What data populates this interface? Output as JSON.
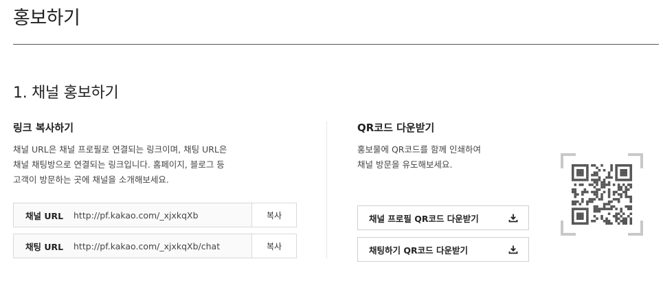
{
  "page": {
    "title": "홍보하기"
  },
  "section": {
    "title": "1. 채널 홍보하기"
  },
  "link_copy": {
    "title": "링크 복사하기",
    "description": [
      "채널 URL은 채널 프로필로 연결되는 링크이며, 채팅 URL은",
      "채널 채팅방으로 연결되는 링크입니다. 홈페이지, 블로그 등",
      "고객이 방문하는 곳에 채널을 소개해보세요."
    ],
    "rows": [
      {
        "label": "채널 URL",
        "url": "http://pf.kakao.com/_xjxkqXb",
        "button": "복사"
      },
      {
        "label": "채팅 URL",
        "url": "http://pf.kakao.com/_xjxkqXb/chat",
        "button": "복사"
      }
    ]
  },
  "qr_download": {
    "title": "QR코드 다운받기",
    "description": [
      "홍보물에 QR코드를 함께 인쇄하여",
      "채널 방문을 유도해보세요."
    ],
    "buttons": [
      {
        "label": "채널 프로필 QR코드 다운받기",
        "icon": "download-icon"
      },
      {
        "label": "채팅하기 QR코드 다운받기",
        "icon": "download-icon"
      }
    ],
    "qr_icon": "qr-code-icon"
  },
  "colors": {
    "text": "#222222",
    "border": "#d9d9d9",
    "rule": "#555555",
    "qr": "#555555",
    "qr_frame": "#c8c8c8"
  }
}
